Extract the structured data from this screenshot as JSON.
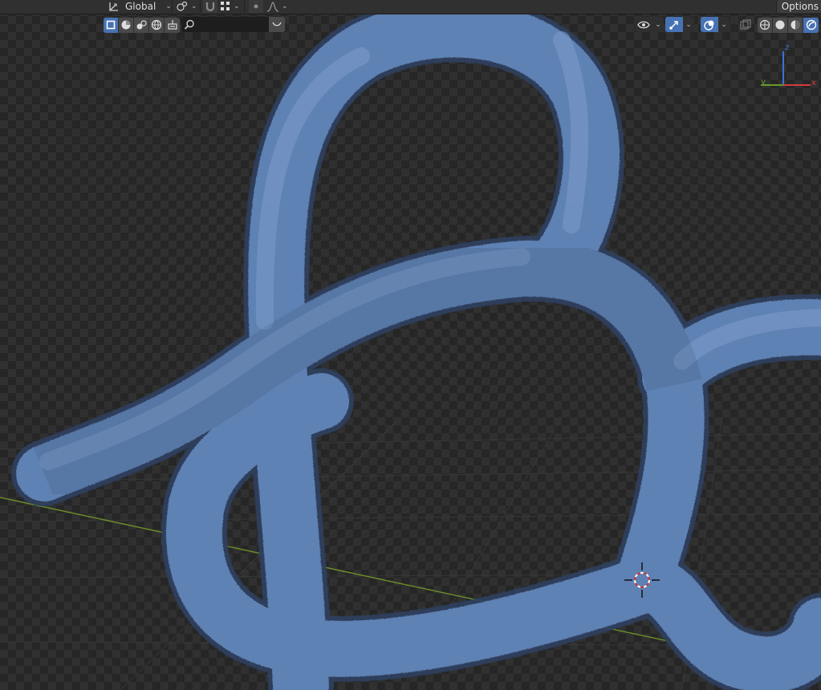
{
  "header": {
    "transform_orientation": "Global",
    "options_label": "Options"
  },
  "toolbar": {
    "select_modes": [
      "select-box-icon",
      "sphere-icon",
      "mesh-icon",
      "globe-icon",
      "brush-icon"
    ],
    "search": {
      "placeholder": "",
      "icon": "search-icon"
    },
    "filter_icon": "filter-icon"
  },
  "viewport_header": {
    "visibility_icon": "eye-icon",
    "gizmo_icon": "gizmo-icon",
    "overlay_icon": "overlay-icon",
    "xray_icon": "xray-icon",
    "shading_modes": [
      "wireframe",
      "solid",
      "material-preview",
      "rendered"
    ],
    "active_shading": "rendered"
  },
  "navigation_gizmo": {
    "x_label": "x",
    "y_label": "y",
    "z_label": "z"
  },
  "colors": {
    "accent": "#4772b3",
    "object": "#5f82b4",
    "x_axis": "#d13b3b",
    "y_axis": "#6a9a2a",
    "z_axis": "#3a73d9"
  }
}
